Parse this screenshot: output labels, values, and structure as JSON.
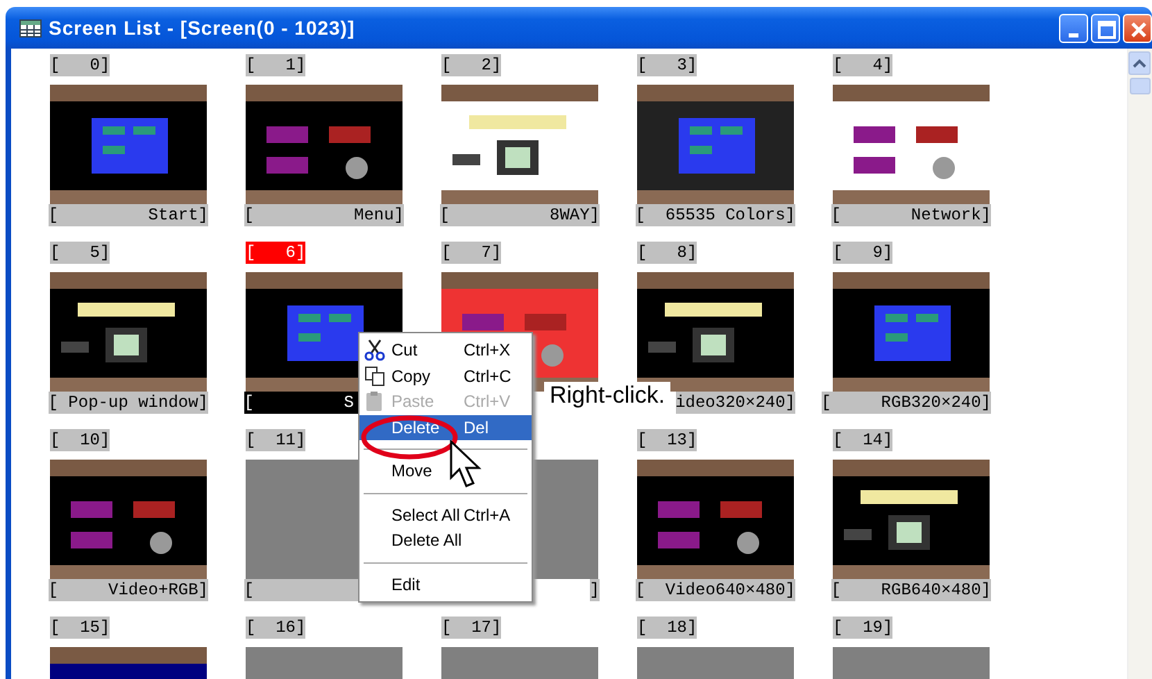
{
  "window": {
    "title": "Screen List - [Screen(0 - 1023)]"
  },
  "screens": [
    {
      "number": "[   0]",
      "caption": "[         Start]",
      "kind": "picture",
      "selected": false
    },
    {
      "number": "[   1]",
      "caption": "[          Menu]",
      "kind": "picture",
      "selected": false
    },
    {
      "number": "[   2]",
      "caption": "[          8WAY]",
      "kind": "picture",
      "selected": false
    },
    {
      "number": "[   3]",
      "caption": "[  65535 Colors]",
      "kind": "picture",
      "selected": false
    },
    {
      "number": "[   4]",
      "caption": "[       Network]",
      "kind": "picture",
      "selected": false
    },
    {
      "number": "[   5]",
      "caption": "[ Pop-up window]",
      "kind": "picture",
      "selected": false
    },
    {
      "number": "[   6]",
      "caption": "[         S     ",
      "kind": "picture",
      "selected": true
    },
    {
      "number": "[   7]",
      "kind": "picture",
      "selected": false
    },
    {
      "number": "[   8]",
      "caption": "ideo320×240]",
      "kind": "picture",
      "selected": false
    },
    {
      "number": "[   9]",
      "caption": "[     RGB320×240]",
      "kind": "picture",
      "selected": false
    },
    {
      "number": "[  10]",
      "caption": "[     Video+RGB]",
      "kind": "picture",
      "selected": false
    },
    {
      "number": "[  11]",
      "caption": "[               ",
      "kind": "empty",
      "selected": false
    },
    {
      "caption": "]",
      "kind": "empty",
      "selected": false
    },
    {
      "number": "[  13]",
      "caption": "[  Video640×480]",
      "kind": "picture",
      "selected": false
    },
    {
      "number": "[  14]",
      "caption": "[    RGB640×480]",
      "kind": "picture",
      "selected": false
    },
    {
      "number": "[  15]",
      "kind": "picture",
      "selected": false
    },
    {
      "number": "[  16]",
      "kind": "empty",
      "selected": false
    },
    {
      "number": "[  17]",
      "kind": "empty",
      "selected": false
    },
    {
      "number": "[  18]",
      "kind": "empty",
      "selected": false
    },
    {
      "number": "[  19]",
      "kind": "empty",
      "selected": false
    }
  ],
  "context_menu": [
    {
      "kind": "icon-item",
      "label": "Cut",
      "shortcut": "Ctrl+X",
      "disabled": false,
      "selected": false
    },
    {
      "kind": "icon-item",
      "label": "Copy",
      "shortcut": "Ctrl+C",
      "disabled": false,
      "selected": false
    },
    {
      "kind": "icon-item",
      "label": "Paste",
      "shortcut": "Ctrl+V",
      "disabled": true,
      "selected": false
    },
    {
      "kind": "item",
      "label": "Delete",
      "shortcut": "Del",
      "disabled": false,
      "selected": true
    },
    {
      "kind": "separator"
    },
    {
      "kind": "item",
      "label": "Move",
      "disabled": false,
      "selected": false
    },
    {
      "kind": "separator"
    },
    {
      "kind": "item",
      "label": "Select All",
      "shortcut": "Ctrl+A",
      "disabled": false,
      "selected": false
    },
    {
      "kind": "item",
      "label": "Delete All",
      "disabled": false,
      "selected": false
    },
    {
      "kind": "separator"
    },
    {
      "kind": "item",
      "label": "Edit",
      "disabled": false,
      "selected": false
    }
  ],
  "annotation": {
    "text": "Right-click."
  }
}
